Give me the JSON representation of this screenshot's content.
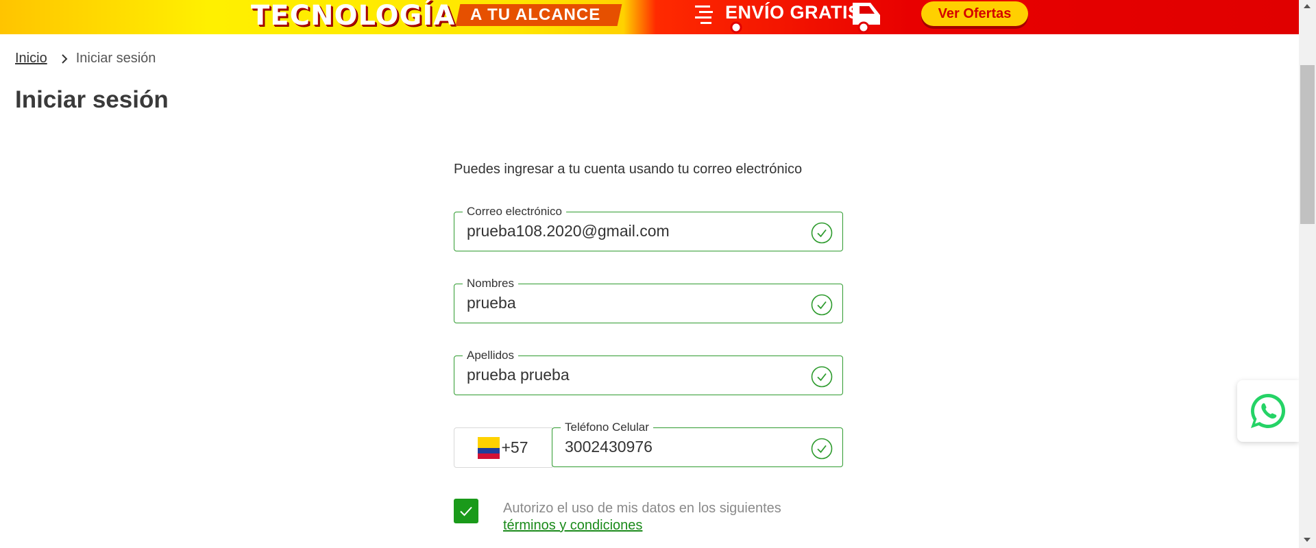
{
  "banner": {
    "headline": "TECNOLOGÍA",
    "tagline": "A TU ALCANCE",
    "shipping": "ENVÍO GRATIS",
    "offers_button": "Ver Ofertas"
  },
  "breadcrumb": {
    "home": "Inicio",
    "current": "Iniciar sesión"
  },
  "page_title": "Iniciar sesión",
  "form": {
    "intro": "Puedes ingresar a tu cuenta usando tu correo electrónico",
    "email": {
      "label": "Correo electrónico",
      "value": "prueba108.2020@gmail.com"
    },
    "nombres": {
      "label": "Nombres",
      "value": "prueba"
    },
    "apellidos": {
      "label": "Apellidos",
      "value": "prueba prueba"
    },
    "phone": {
      "country_code": "+57",
      "label": "Teléfono Celular",
      "value": "3002430976"
    },
    "consent": {
      "text": "Autorizo el uso de mis datos en los siguientes",
      "link": "términos y condiciones",
      "checked": true
    }
  },
  "colors": {
    "valid_green": "#2e9b2e",
    "checkbox_green": "#1a9a1a",
    "whatsapp_green": "#25d366"
  }
}
